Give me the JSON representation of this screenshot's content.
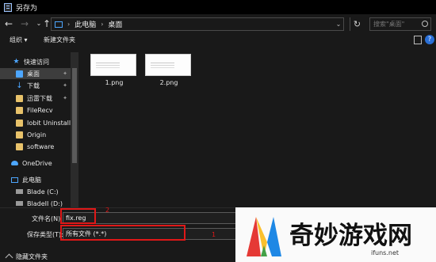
{
  "window": {
    "title": "另存为"
  },
  "address": {
    "crumbs": [
      "此电脑",
      "桌面"
    ],
    "search_placeholder": "搜索\"桌面\""
  },
  "toolbar": {
    "organize": "组织 ▾",
    "new_folder": "新建文件夹"
  },
  "sidebar": {
    "items": [
      {
        "label": "快速访问",
        "icon": "star-icon"
      },
      {
        "label": "桌面",
        "icon": "desktop-folder-icon",
        "pinned": true,
        "selected": true
      },
      {
        "label": "下载",
        "icon": "download-icon",
        "pinned": true
      },
      {
        "label": "迅雷下载",
        "icon": "folder-icon",
        "pinned": true
      },
      {
        "label": "FileRecv",
        "icon": "folder-icon"
      },
      {
        "label": "Iobit Uninstalle",
        "icon": "folder-icon"
      },
      {
        "label": "Origin",
        "icon": "folder-icon"
      },
      {
        "label": "software",
        "icon": "folder-icon"
      },
      {
        "label": "OneDrive",
        "icon": "cloud-icon"
      },
      {
        "label": "此电脑",
        "icon": "pc-icon"
      },
      {
        "label": "Blade (C:)",
        "icon": "drive-icon"
      },
      {
        "label": "BladeII (D:)",
        "icon": "drive-icon"
      }
    ]
  },
  "files": [
    {
      "name": "1.png"
    },
    {
      "name": "2.png"
    }
  ],
  "form": {
    "filename_label": "文件名(N):",
    "filename_value": "fix.reg",
    "filetype_label": "保存类型(T):",
    "filetype_value": "所有文件 (*.*)",
    "hide_folders": "隐藏文件夹"
  },
  "annotations": {
    "box1_number": "1",
    "box2_number": "2",
    "color": "#e01818"
  },
  "watermark": {
    "brand": "奇妙游戏网",
    "url": "ifuns.net"
  }
}
